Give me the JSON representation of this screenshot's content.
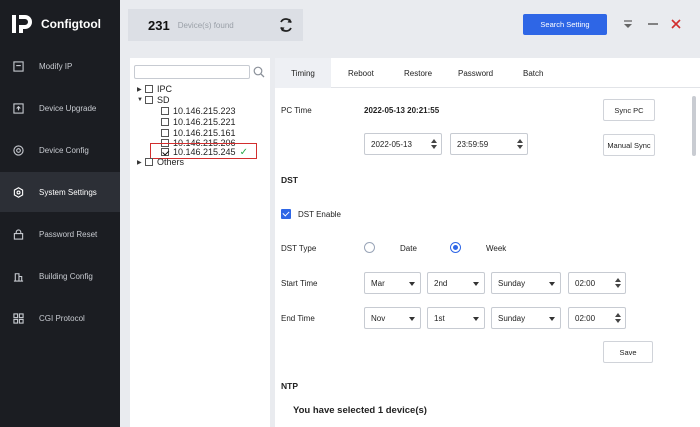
{
  "app": {
    "title": "Configtool"
  },
  "sidebar": {
    "items": [
      {
        "label": "Modify IP",
        "icon": "edit-icon"
      },
      {
        "label": "Device Upgrade",
        "icon": "upload-icon"
      },
      {
        "label": "Device Config",
        "icon": "target-icon"
      },
      {
        "label": "System Settings",
        "icon": "settings-icon"
      },
      {
        "label": "Password Reset",
        "icon": "lock-icon"
      },
      {
        "label": "Building Config",
        "icon": "building-icon"
      },
      {
        "label": "CGI Protocol",
        "icon": "grid-icon"
      }
    ],
    "active": "System Settings"
  },
  "topbar": {
    "device_count": "231",
    "device_label": "Device(s) found",
    "search_button": "Search Setting"
  },
  "tree": {
    "search_placeholder": "",
    "groups": [
      {
        "label": "IPC",
        "expanded": false,
        "checked": false
      },
      {
        "label": "SD",
        "expanded": true,
        "checked": false
      },
      {
        "label": "Others",
        "expanded": false,
        "checked": false
      }
    ],
    "sd_devices": [
      {
        "ip": "10.146.215.223",
        "checked": false
      },
      {
        "ip": "10.146.215.221",
        "checked": false
      },
      {
        "ip": "10.146.215.161",
        "checked": false
      },
      {
        "ip": "10.146.215.206",
        "checked": false
      },
      {
        "ip": "10.146.215.245",
        "checked": true
      }
    ]
  },
  "tabs": [
    "Timing",
    "Reboot",
    "Restore",
    "Password",
    "Batch"
  ],
  "active_tab": "Timing",
  "timing": {
    "pc_time_label": "PC Time",
    "pc_time_value": "2022-05-13 20:21:55",
    "sync_pc_button": "Sync PC",
    "date_value": "2022-05-13",
    "time_value": "23:59:59",
    "manual_sync_button": "Manual Sync",
    "dst_section": "DST",
    "dst_enable_label": "DST Enable",
    "dst_enabled": true,
    "dst_type_label": "DST Type",
    "dst_type_date": "Date",
    "dst_type_week": "Week",
    "dst_type_selected": "Week",
    "start_time_label": "Start Time",
    "start_month": "Mar",
    "start_week": "2nd",
    "start_day": "Sunday",
    "start_time": "02:00",
    "end_time_label": "End Time",
    "end_month": "Nov",
    "end_week": "1st",
    "end_day": "Sunday",
    "end_time": "02:00",
    "save_button": "Save",
    "ntp_section": "NTP"
  },
  "status_text": "You have selected 1 device(s)",
  "colors": {
    "accent": "#2e66e6",
    "sidebar": "#1b1d22",
    "highlight": "#d22e2e",
    "success": "#29a84a"
  }
}
